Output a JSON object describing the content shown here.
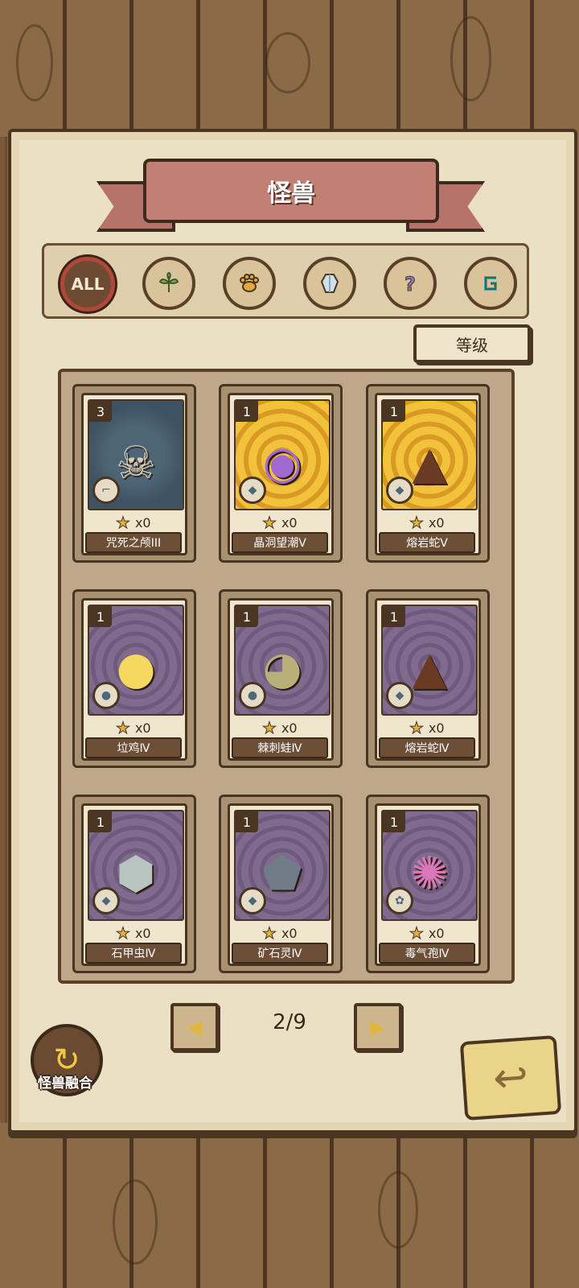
{
  "title": "怪兽",
  "filters": [
    {
      "id": "all",
      "label": "ALL",
      "icon": "all-badge-icon",
      "active": true
    },
    {
      "id": "plant",
      "label": "",
      "icon": "leaf-icon"
    },
    {
      "id": "beast",
      "label": "",
      "icon": "paw-icon"
    },
    {
      "id": "crystal",
      "label": "",
      "icon": "crystal-icon"
    },
    {
      "id": "unknown",
      "label": "",
      "icon": "question-icon"
    },
    {
      "id": "spirit",
      "label": "",
      "icon": "swirl-icon"
    }
  ],
  "sort_label": "等级",
  "cards": [
    {
      "level": "3",
      "count": "x0",
      "name": "咒死之颅III",
      "theme": "slate",
      "element": "swirl-icon",
      "creature": "skull-icon"
    },
    {
      "level": "1",
      "count": "x0",
      "name": "晶洞望潮Ⅴ",
      "theme": "gold",
      "element": "crystal-icon",
      "creature": "crystal-octopus-icon"
    },
    {
      "level": "1",
      "count": "x0",
      "name": "熔岩蛇Ⅴ",
      "theme": "gold",
      "element": "crystal-icon",
      "creature": "lava-snake-icon"
    },
    {
      "level": "1",
      "count": "x0",
      "name": "垃鸡Ⅳ",
      "theme": "purple",
      "element": "paw-icon",
      "creature": "chick-icon"
    },
    {
      "level": "1",
      "count": "x0",
      "name": "棘刺蛙Ⅳ",
      "theme": "purple",
      "element": "paw-icon",
      "creature": "spiky-toad-icon"
    },
    {
      "level": "1",
      "count": "x0",
      "name": "熔岩蛇Ⅳ",
      "theme": "purple",
      "element": "crystal-icon",
      "creature": "lava-snake-icon"
    },
    {
      "level": "1",
      "count": "x0",
      "name": "石甲虫Ⅳ",
      "theme": "purple",
      "element": "crystal-icon",
      "creature": "rock-beetle-icon"
    },
    {
      "level": "1",
      "count": "x0",
      "name": "矿石灵Ⅳ",
      "theme": "purple",
      "element": "crystal-icon",
      "creature": "ore-spirit-icon"
    },
    {
      "level": "1",
      "count": "x0",
      "name": "毒气孢Ⅳ",
      "theme": "purple",
      "element": "leaf-icon",
      "creature": "spore-icon"
    }
  ],
  "pagination": {
    "page": "2/9"
  },
  "fuse_label": "怪兽融合",
  "colors": {
    "ribbon": "#c27f74",
    "panel": "#ece0c4",
    "wood": "#7a5a3a",
    "gold_card": "#f2c33a",
    "purple_card": "#806a8e"
  }
}
